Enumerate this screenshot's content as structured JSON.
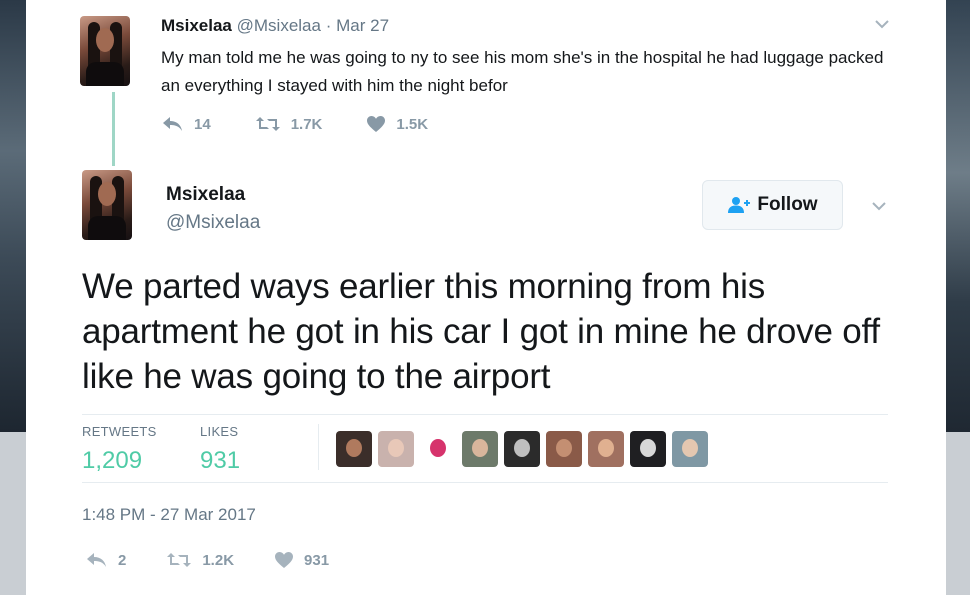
{
  "parent_tweet": {
    "name": "Msixelaa",
    "handle": "@Msixelaa",
    "separator": "·",
    "date": "Mar 27",
    "text": "My man told me he was going to ny to see his mom she's in the hospital he had luggage packed an everything I stayed with him the night befor",
    "replies": "14",
    "retweets": "1.7K",
    "likes": "1.5K"
  },
  "main_tweet": {
    "name": "Msixelaa",
    "handle": "@Msixelaa",
    "follow_label": "Follow",
    "text": "We parted ways earlier this morning from his apartment  he got in his car I got in mine he drove off like he was going  to the airport",
    "stats": {
      "retweets_label": "RETWEETS",
      "retweets_value": "1,209",
      "likes_label": "LIKES",
      "likes_value": "931"
    },
    "timestamp": "1:48 PM - 27 Mar 2017",
    "replies": "2",
    "retweets": "1.2K",
    "likes": "931"
  },
  "likers": [
    {
      "bg": "#3b2e2a",
      "face": "#b07a5e"
    },
    {
      "bg": "#c9b2ad",
      "face": "#e8c8b8"
    },
    {
      "bg": "#ffffff",
      "face": "#d6336c"
    },
    {
      "bg": "#6d7a6a",
      "face": "#d9b69c"
    },
    {
      "bg": "#2b2b2b",
      "face": "#bfbfbf"
    },
    {
      "bg": "#8a5a48",
      "face": "#c48f72"
    },
    {
      "bg": "#a07060",
      "face": "#e0b090"
    },
    {
      "bg": "#1f1f22",
      "face": "#d8d8d8"
    },
    {
      "bg": "#7f98a4",
      "face": "#e4c7b0"
    }
  ],
  "colors": {
    "accent_green": "#4fcba6",
    "thread_line": "#9fd6c6",
    "muted": "#657786",
    "icon_gray": "#8899a6"
  }
}
